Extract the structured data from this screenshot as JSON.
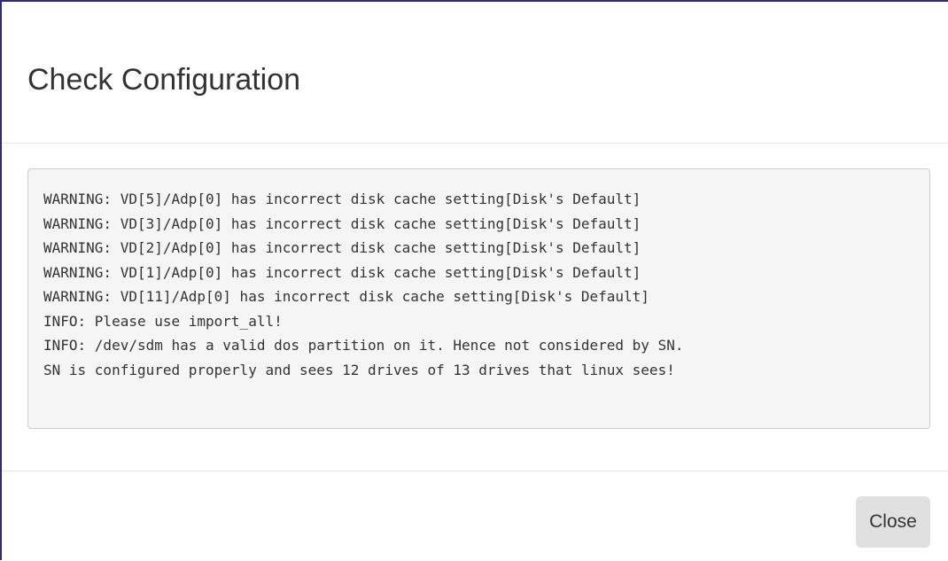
{
  "dialog": {
    "title": "Check Configuration",
    "log_lines": [
      "WARNING: VD[5]/Adp[0] has incorrect disk cache setting[Disk's Default]",
      "WARNING: VD[3]/Adp[0] has incorrect disk cache setting[Disk's Default]",
      "WARNING: VD[2]/Adp[0] has incorrect disk cache setting[Disk's Default]",
      "WARNING: VD[1]/Adp[0] has incorrect disk cache setting[Disk's Default]",
      "WARNING: VD[11]/Adp[0] has incorrect disk cache setting[Disk's Default]",
      "INFO: Please use import_all!",
      "INFO: /dev/sdm has a valid dos partition on it. Hence not considered by SN.",
      "SN is configured properly and sees 12 drives of 13 drives that linux sees!"
    ],
    "close_label": "Close"
  },
  "colors": {
    "border_accent": "#2b2d7a",
    "log_background": "#f5f5f5",
    "button_background": "#e0e0e0",
    "text": "#333333"
  }
}
